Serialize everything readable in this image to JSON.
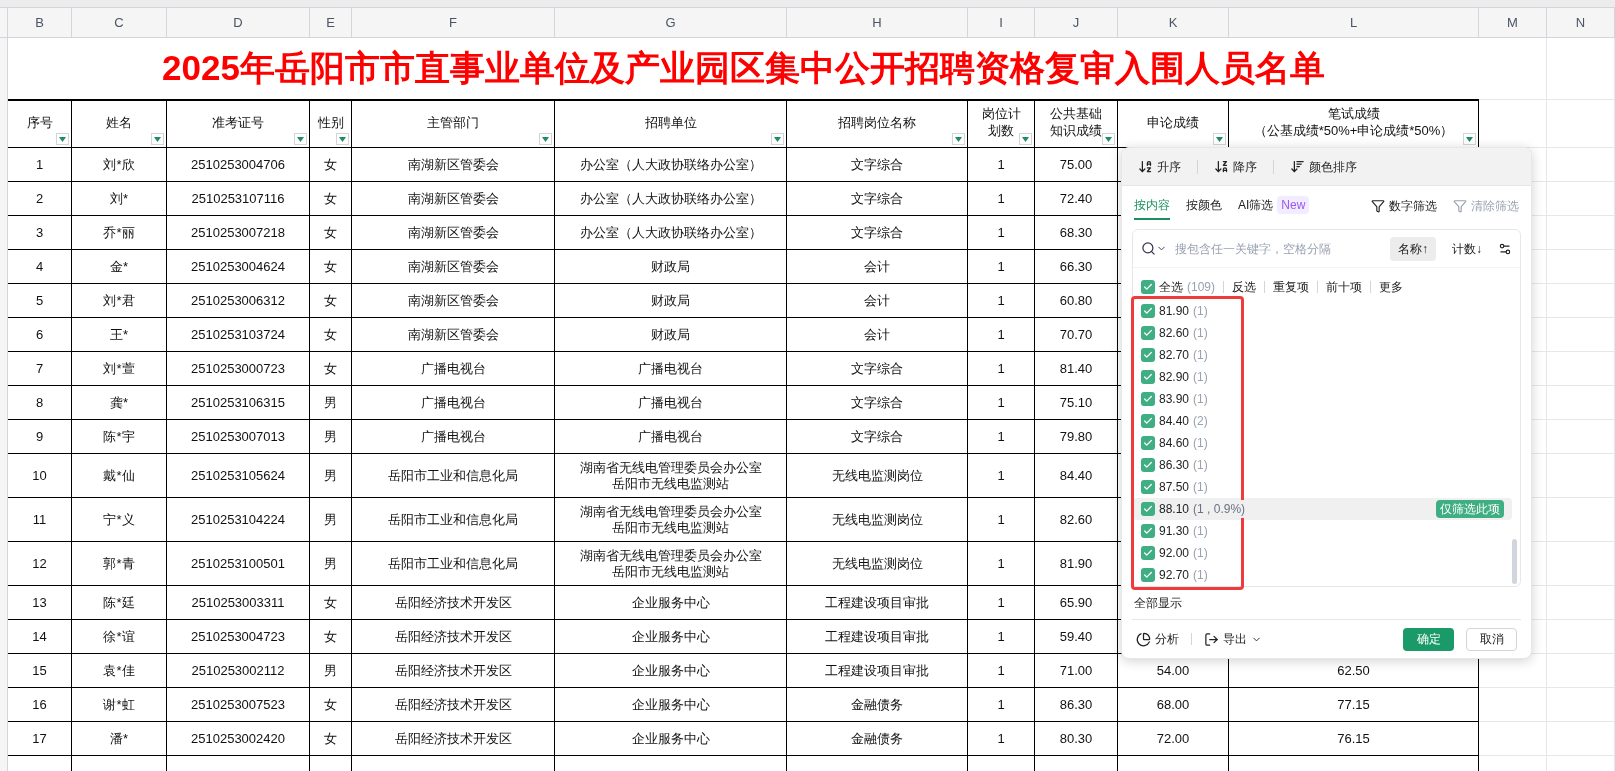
{
  "column_letters": [
    "B",
    "C",
    "D",
    "E",
    "F",
    "G",
    "H",
    "I",
    "J",
    "K",
    "L",
    "M",
    "N"
  ],
  "title": "2025年岳阳市市直事业单位及产业园区集中公开招聘资格复审入围人员名单",
  "table": {
    "columns": [
      {
        "lines": [
          "序号"
        ]
      },
      {
        "lines": [
          "姓名"
        ]
      },
      {
        "lines": [
          "准考证号"
        ]
      },
      {
        "lines": [
          "性别"
        ]
      },
      {
        "lines": [
          "主管部门"
        ]
      },
      {
        "lines": [
          "招聘单位"
        ]
      },
      {
        "lines": [
          "招聘岗位名称"
        ]
      },
      {
        "lines": [
          "岗位计",
          "划数"
        ]
      },
      {
        "lines": [
          "公共基础",
          "知识成绩"
        ]
      },
      {
        "lines": [
          "申论成绩"
        ]
      },
      {
        "lines": [
          "笔试成绩",
          "（公基成绩*50%+申论成绩*50%）"
        ]
      }
    ],
    "rows": [
      {
        "seq": "1",
        "name": "刘*欣",
        "exam_id": "2510253004706",
        "gender": "女",
        "department": "南湖新区管委会",
        "unit": [
          "办公室（人大政协联络办公室）"
        ],
        "post": "文字综合",
        "plan": "1",
        "basic_score": "75.00"
      },
      {
        "seq": "2",
        "name": "刘*",
        "exam_id": "2510253107116",
        "gender": "女",
        "department": "南湖新区管委会",
        "unit": [
          "办公室（人大政协联络办公室）"
        ],
        "post": "文字综合",
        "plan": "1",
        "basic_score": "72.40"
      },
      {
        "seq": "3",
        "name": "乔*丽",
        "exam_id": "2510253007218",
        "gender": "女",
        "department": "南湖新区管委会",
        "unit": [
          "办公室（人大政协联络办公室）"
        ],
        "post": "文字综合",
        "plan": "1",
        "basic_score": "68.30"
      },
      {
        "seq": "4",
        "name": "金*",
        "exam_id": "2510253004624",
        "gender": "女",
        "department": "南湖新区管委会",
        "unit": [
          "财政局"
        ],
        "post": "会计",
        "plan": "1",
        "basic_score": "66.30"
      },
      {
        "seq": "5",
        "name": "刘*君",
        "exam_id": "2510253006312",
        "gender": "女",
        "department": "南湖新区管委会",
        "unit": [
          "财政局"
        ],
        "post": "会计",
        "plan": "1",
        "basic_score": "60.80"
      },
      {
        "seq": "6",
        "name": "王*",
        "exam_id": "2510253103724",
        "gender": "女",
        "department": "南湖新区管委会",
        "unit": [
          "财政局"
        ],
        "post": "会计",
        "plan": "1",
        "basic_score": "70.70"
      },
      {
        "seq": "7",
        "name": "刘*萱",
        "exam_id": "2510253000723",
        "gender": "女",
        "department": "广播电视台",
        "unit": [
          "广播电视台"
        ],
        "post": "文字综合",
        "plan": "1",
        "basic_score": "81.40"
      },
      {
        "seq": "8",
        "name": "龚*",
        "exam_id": "2510253106315",
        "gender": "男",
        "department": "广播电视台",
        "unit": [
          "广播电视台"
        ],
        "post": "文字综合",
        "plan": "1",
        "basic_score": "75.10"
      },
      {
        "seq": "9",
        "name": "陈*宇",
        "exam_id": "2510253007013",
        "gender": "男",
        "department": "广播电视台",
        "unit": [
          "广播电视台"
        ],
        "post": "文字综合",
        "plan": "1",
        "basic_score": "79.80"
      },
      {
        "seq": "10",
        "name": "戴*仙",
        "exam_id": "2510253105624",
        "gender": "男",
        "department": "岳阳市工业和信息化局",
        "unit": [
          "湖南省无线电管理委员会办公室",
          "岳阳市无线电监测站"
        ],
        "post": "无线电监测岗位",
        "plan": "1",
        "basic_score": "84.40"
      },
      {
        "seq": "11",
        "name": "宁*义",
        "exam_id": "2510253104224",
        "gender": "男",
        "department": "岳阳市工业和信息化局",
        "unit": [
          "湖南省无线电管理委员会办公室",
          "岳阳市无线电监测站"
        ],
        "post": "无线电监测岗位",
        "plan": "1",
        "basic_score": "82.60"
      },
      {
        "seq": "12",
        "name": "郭*青",
        "exam_id": "2510253100501",
        "gender": "男",
        "department": "岳阳市工业和信息化局",
        "unit": [
          "湖南省无线电管理委员会办公室",
          "岳阳市无线电监测站"
        ],
        "post": "无线电监测岗位",
        "plan": "1",
        "basic_score": "81.90"
      },
      {
        "seq": "13",
        "name": "陈*廷",
        "exam_id": "2510253003311",
        "gender": "女",
        "department": "岳阳经济技术开发区",
        "unit": [
          "企业服务中心"
        ],
        "post": "工程建设项目审批",
        "plan": "1",
        "basic_score": "65.90"
      },
      {
        "seq": "14",
        "name": "徐*谊",
        "exam_id": "2510253004723",
        "gender": "女",
        "department": "岳阳经济技术开发区",
        "unit": [
          "企业服务中心"
        ],
        "post": "工程建设项目审批",
        "plan": "1",
        "basic_score": "59.40"
      },
      {
        "seq": "15",
        "name": "袁*佳",
        "exam_id": "2510253002112",
        "gender": "男",
        "department": "岳阳经济技术开发区",
        "unit": [
          "企业服务中心"
        ],
        "post": "工程建设项目审批",
        "plan": "1",
        "basic_score": "71.00",
        "essay_score": "54.00",
        "written_score": "62.50"
      },
      {
        "seq": "16",
        "name": "谢*虹",
        "exam_id": "2510253007523",
        "gender": "女",
        "department": "岳阳经济技术开发区",
        "unit": [
          "企业服务中心"
        ],
        "post": "金融债务",
        "plan": "1",
        "basic_score": "86.30",
        "essay_score": "68.00",
        "written_score": "77.15"
      },
      {
        "seq": "17",
        "name": "潘*",
        "exam_id": "2510253002420",
        "gender": "女",
        "department": "岳阳经济技术开发区",
        "unit": [
          "企业服务中心"
        ],
        "post": "金融债务",
        "plan": "1",
        "basic_score": "80.30",
        "essay_score": "72.00",
        "written_score": "76.15"
      }
    ]
  },
  "filter_panel": {
    "sort_buttons": [
      {
        "kind": "ascending",
        "label": "升序"
      },
      {
        "kind": "descending",
        "label": "降序"
      },
      {
        "kind": "color",
        "label": "颜色排序"
      }
    ],
    "tabs": [
      {
        "label": "按内容",
        "selected": true
      },
      {
        "label": "按颜色",
        "selected": false
      },
      {
        "label": "AI筛选",
        "selected": false,
        "badge": "New"
      }
    ],
    "actions": [
      {
        "label": "数字筛选",
        "disabled": false
      },
      {
        "label": "清除筛选",
        "disabled": true
      }
    ],
    "search": {
      "placeholder": "搜包含任一关键字，空格分隔"
    },
    "sort_options": [
      {
        "label": "名称↑",
        "selected": true
      },
      {
        "label": "计数↓",
        "selected": false
      }
    ],
    "select_all": {
      "label": "全选",
      "count": "(109)",
      "checked": true
    },
    "quick_links": [
      "反选",
      "重复项",
      "前十项",
      "更多"
    ],
    "items": [
      {
        "value": "81.90",
        "count": "(1)",
        "checked": true,
        "highlighted": false
      },
      {
        "value": "82.60",
        "count": "(1)",
        "checked": true,
        "highlighted": false
      },
      {
        "value": "82.70",
        "count": "(1)",
        "checked": true,
        "highlighted": false
      },
      {
        "value": "82.90",
        "count": "(1)",
        "checked": true,
        "highlighted": false
      },
      {
        "value": "83.90",
        "count": "(1)",
        "checked": true,
        "highlighted": false
      },
      {
        "value": "84.40",
        "count": "(2)",
        "checked": true,
        "highlighted": false
      },
      {
        "value": "84.60",
        "count": "(1)",
        "checked": true,
        "highlighted": false
      },
      {
        "value": "86.30",
        "count": "(1)",
        "checked": true,
        "highlighted": false
      },
      {
        "value": "87.50",
        "count": "(1)",
        "checked": true,
        "highlighted": false
      },
      {
        "value": "88.10",
        "count": "(1 , 0.9%)",
        "checked": true,
        "highlighted": true,
        "action": "仅筛选此项"
      },
      {
        "value": "91.30",
        "count": "(1)",
        "checked": true,
        "highlighted": false
      },
      {
        "value": "92.00",
        "count": "(1)",
        "checked": true,
        "highlighted": false
      },
      {
        "value": "92.70",
        "count": "(1)",
        "checked": true,
        "highlighted": false
      }
    ],
    "show_all": "全部显示",
    "footer_tools": [
      {
        "kind": "analyze",
        "label": "分析"
      },
      {
        "kind": "export",
        "label": "导出"
      }
    ],
    "buttons": [
      {
        "kind": "primary",
        "label": "确定"
      },
      {
        "kind": "secondary",
        "label": "取消"
      }
    ]
  }
}
